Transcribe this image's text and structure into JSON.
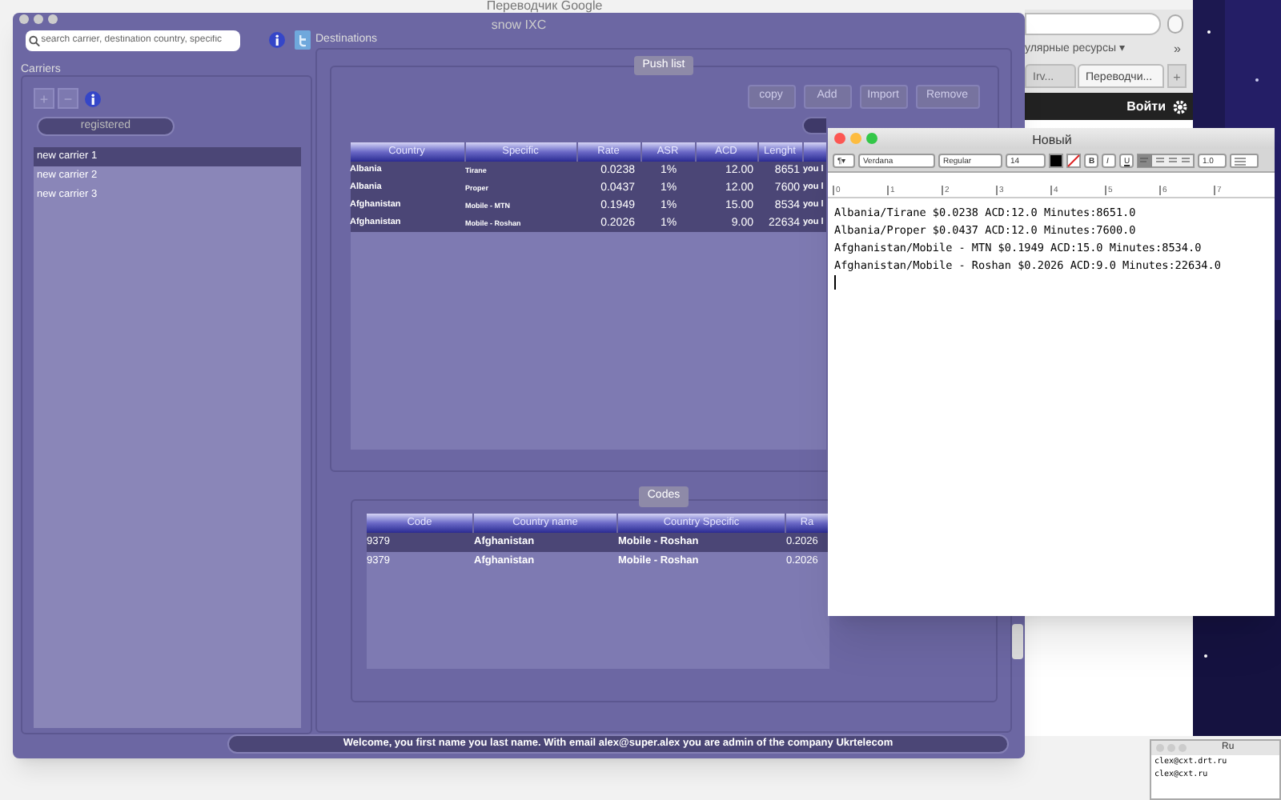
{
  "browser": {
    "title": "Переводчик Google",
    "bookmarks": "улярные ресурсы ▾",
    "overflow": "»",
    "tabs": [
      {
        "label": "Irv...",
        "selected": false
      },
      {
        "label": "Переводчи...",
        "selected": true
      }
    ],
    "new_tab": "+",
    "login": "Войти"
  },
  "app": {
    "title": "snow IXC",
    "search": {
      "placeholder": "search carrier, destination country, specific"
    },
    "carriers": {
      "title": "Carriers",
      "add": "+",
      "remove": "−",
      "filter": "registered",
      "items": [
        {
          "label": "new carrier 1",
          "selected": true
        },
        {
          "label": "new carrier 2",
          "selected": false
        },
        {
          "label": "new carrier 3",
          "selected": false
        }
      ]
    },
    "destinations": {
      "title": "Destinations",
      "push_list": "Push list",
      "buttons": [
        {
          "label": "copy",
          "disabled": true
        },
        {
          "label": "Add",
          "disabled": true
        },
        {
          "label": "Import",
          "disabled": true
        },
        {
          "label": "Remove",
          "disabled": true
        }
      ],
      "table": {
        "columns": [
          "Country",
          "Specific",
          "Rate",
          "ASR",
          "ACD",
          "Lenght"
        ],
        "rows": [
          [
            "Albania",
            "Tirane",
            "0.0238",
            "1%",
            "12.00",
            "8651",
            "you l"
          ],
          [
            "Albania",
            "Proper",
            "0.0437",
            "1%",
            "12.00",
            "7600",
            "you l"
          ],
          [
            "Afghanistan",
            "Mobile - MTN",
            "0.1949",
            "1%",
            "15.00",
            "8534",
            "you l"
          ],
          [
            "Afghanistan",
            "Mobile - Roshan",
            "0.2026",
            "1%",
            "9.00",
            "22634",
            "you l"
          ]
        ]
      }
    },
    "codes": {
      "title": "Codes",
      "table": {
        "columns": [
          "Code",
          "Country name",
          "Country Specific",
          "Ra"
        ],
        "rows": [
          {
            "cells": [
              "9379",
              "Afghanistan",
              "Mobile - Roshan",
              "0.2026"
            ],
            "selected": true
          },
          {
            "cells": [
              "9379",
              "Afghanistan",
              "Mobile - Roshan",
              "0.2026"
            ],
            "selected": false
          }
        ]
      }
    },
    "status": "Welcome, you first name you last name. With email alex@super.alex you are admin of the company Ukrtelecom"
  },
  "textedit": {
    "title": "Новый",
    "paragraph": "¶▾",
    "font": "Verdana",
    "style": "Regular",
    "size": "14",
    "bold": "B",
    "italic": "I",
    "underline": "U",
    "spacing": "1.0",
    "ruler": [
      "0",
      "1",
      "2",
      "3",
      "4",
      "5",
      "6",
      "7"
    ],
    "lines": [
      "Albania/Tirane $0.0238 ACD:12.0 Minutes:8651.0",
      "Albania/Proper $0.0437 ACD:12.0 Minutes:7600.0",
      "Afghanistan/Mobile - MTN $0.1949 ACD:15.0 Minutes:8534.0",
      "Afghanistan/Mobile - Roshan $0.2026 ACD:9.0 Minutes:22634.0"
    ]
  },
  "terminal": {
    "title": "Ru",
    "lines": [
      "clex@cxt.drt.ru",
      "clex@cxt.ru"
    ]
  }
}
